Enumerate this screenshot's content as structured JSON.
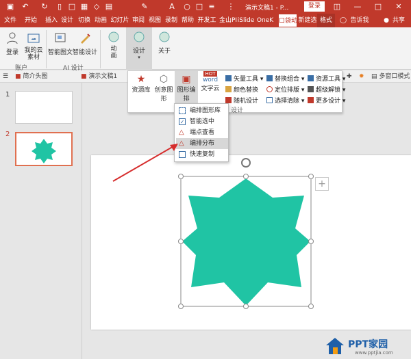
{
  "titlebar": {
    "doc_title": "演示文稿1 - P...",
    "login": "登录",
    "icons": [
      "save-icon",
      "undo-icon",
      "redo-icon",
      "new-file-icon",
      "open-icon",
      "chart-icon",
      "shape-icon",
      "text-icon",
      "eyedropper-icon",
      "font-color-icon",
      "circle-icon",
      "square-icon",
      "align-icon",
      "more-icon"
    ]
  },
  "tabs": [
    "文件",
    "开始",
    "插入",
    "设计",
    "切换",
    "动画",
    "幻灯片",
    "审阅",
    "视图",
    "录制",
    "帮助",
    "开发工",
    "金山PI",
    "iSlide",
    "OneK",
    "口袋动",
    "新建选",
    "格式",
    "告诉我",
    "共享"
  ],
  "ribbon": {
    "account": {
      "login": "登录",
      "cloud": "我的云素材",
      "group": "账户"
    },
    "ai": {
      "smart_graphic": "智能图文",
      "smart_design": "智能设计",
      "group": "AI 设计"
    },
    "anim": "动画",
    "design": "设计",
    "about": "关于"
  },
  "docstrip": {
    "tab1": "简介头图",
    "tab2": "演示文稿1",
    "right": "多窗口模式"
  },
  "panel": {
    "resource": "资源库",
    "creative": "创意图形",
    "layout": "图形编排",
    "wordcloud": "文字云",
    "wordcloud_badge": "HOT",
    "vector": "矢量工具",
    "color_replace": "颜色替换",
    "random_design": "随机设计",
    "replace_combo": "替换组合",
    "position_layout": "定位排版",
    "select_clear": "选择清除",
    "resource_tools": "资源工具",
    "super_unlock": "超级解锁",
    "more_design": "更多设计",
    "group_label": "设计"
  },
  "menu": {
    "items": [
      "编排图形库",
      "智能选中",
      "端点查看",
      "编排分布",
      "快速复制"
    ],
    "highlighted": 3
  },
  "slides": {
    "numbers": [
      "1",
      "2"
    ]
  },
  "shape": {
    "fill": "#20c4a4",
    "name": "octagram"
  },
  "colors": {
    "accent": "#c0392b",
    "shape": "#20c4a4"
  },
  "watermark": {
    "brand": "PPT家园",
    "url": "www.pptjia.com"
  }
}
